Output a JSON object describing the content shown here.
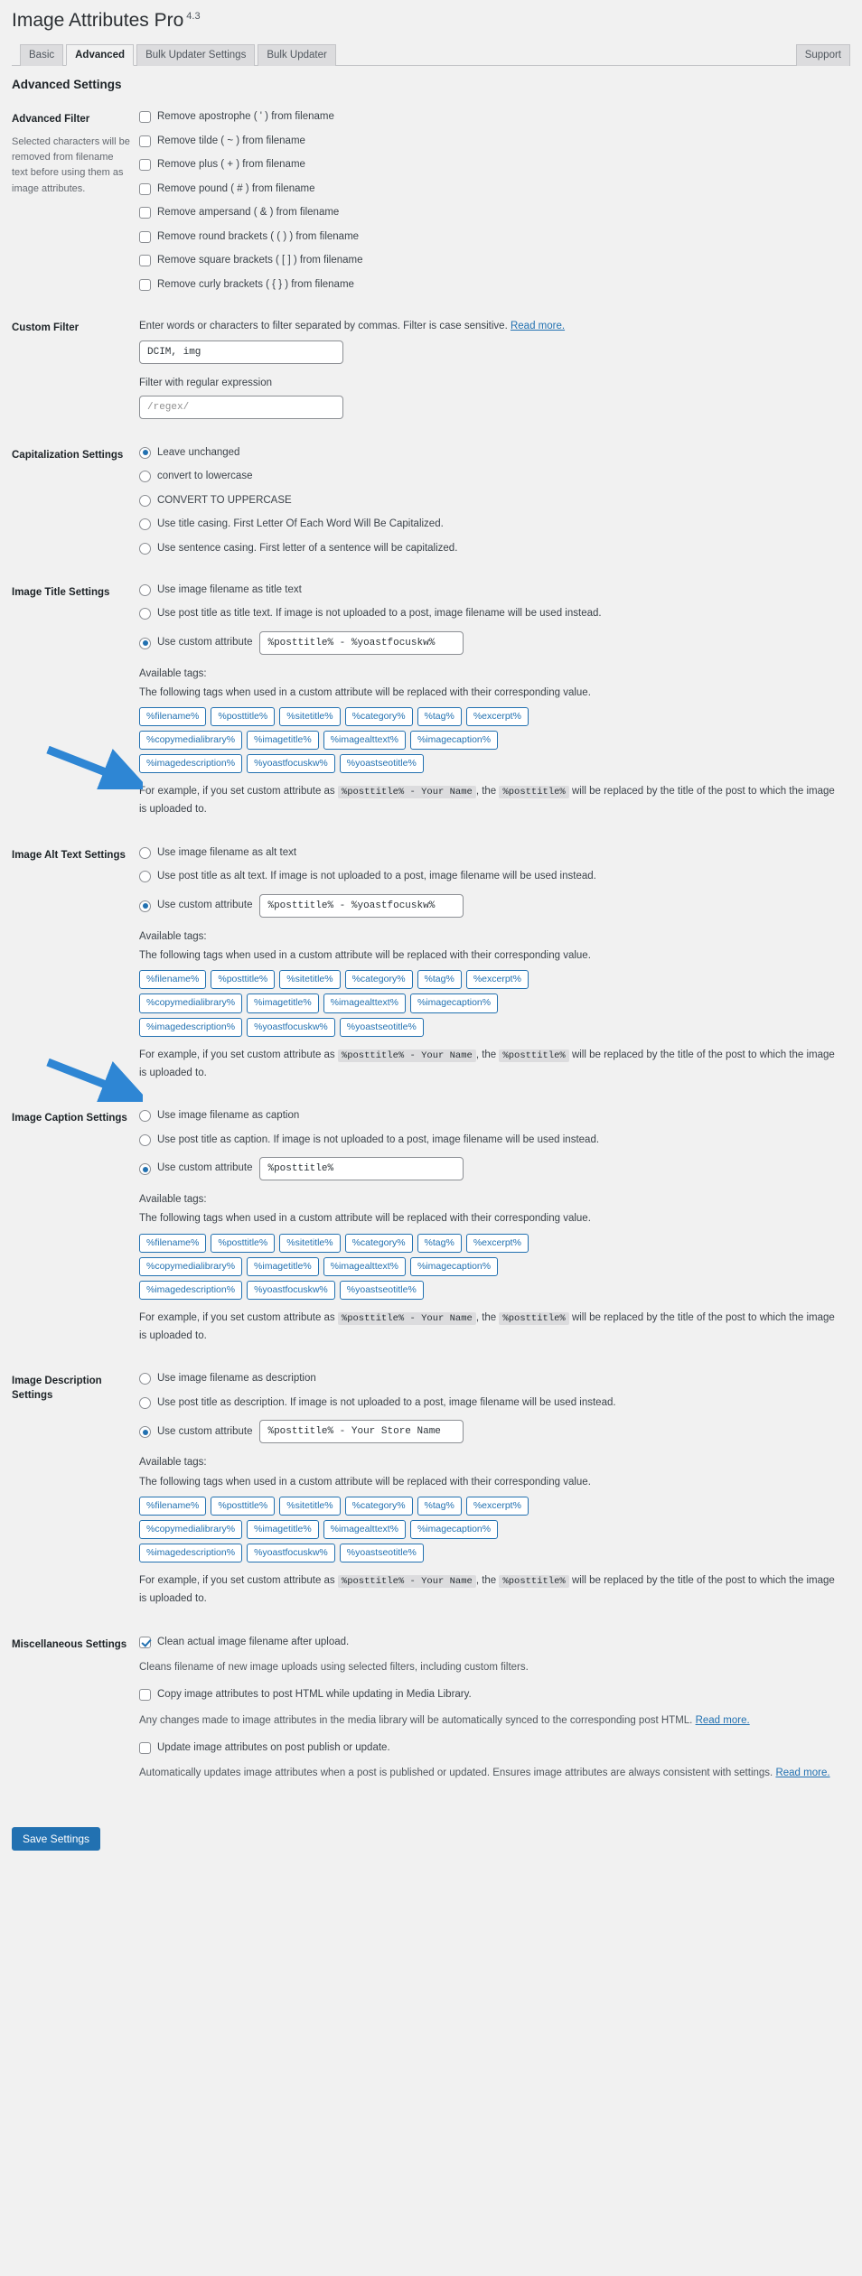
{
  "header": {
    "title": "Image Attributes Pro",
    "version": "4.3"
  },
  "tabs": [
    {
      "label": "Basic",
      "active": false
    },
    {
      "label": "Advanced",
      "active": true
    },
    {
      "label": "Bulk Updater Settings",
      "active": false
    },
    {
      "label": "Bulk Updater",
      "active": false
    }
  ],
  "support_tab": {
    "label": "Support"
  },
  "page_heading": "Advanced Settings",
  "advanced_filter": {
    "label": "Advanced Filter",
    "description": "Selected characters will be removed from filename text before using them as image attributes.",
    "options": [
      {
        "label": "Remove apostrophe ( ' ) from filename",
        "checked": false
      },
      {
        "label": "Remove tilde ( ~ ) from filename",
        "checked": false
      },
      {
        "label": "Remove plus ( + ) from filename",
        "checked": false
      },
      {
        "label": "Remove pound ( # ) from filename",
        "checked": false
      },
      {
        "label": "Remove ampersand ( & ) from filename",
        "checked": false
      },
      {
        "label": "Remove round brackets ( ( ) ) from filename",
        "checked": false
      },
      {
        "label": "Remove square brackets ( [ ] ) from filename",
        "checked": false
      },
      {
        "label": "Remove curly brackets ( { } ) from filename",
        "checked": false
      }
    ]
  },
  "custom_filter": {
    "label": "Custom Filter",
    "note": "Enter words or characters to filter separated by commas. Filter is case sensitive.",
    "read_more": "Read more.",
    "words_value": "DCIM, img",
    "regex_note": "Filter with regular expression",
    "regex_placeholder": "/regex/",
    "regex_value": ""
  },
  "capitalization": {
    "label": "Capitalization Settings",
    "options": [
      {
        "label": "Leave unchanged",
        "selected": true
      },
      {
        "label": "convert to lowercase",
        "selected": false
      },
      {
        "label": "CONVERT TO UPPERCASE",
        "selected": false
      },
      {
        "label": "Use title casing. First Letter Of Each Word Will Be Capitalized.",
        "selected": false
      },
      {
        "label": "Use sentence casing. First letter of a sentence will be capitalized.",
        "selected": false
      }
    ]
  },
  "tags_common": {
    "available_label": "Available tags:",
    "available_sub": "The following tags when used in a custom attribute will be replaced with their corresponding value.",
    "chips": [
      "%filename%",
      "%posttitle%",
      "%sitetitle%",
      "%category%",
      "%tag%",
      "%excerpt%",
      "%copymedialibrary%",
      "%imagetitle%",
      "%imagealttext%",
      "%imagecaption%",
      "%imagedescription%",
      "%yoastfocuskw%",
      "%yoastseotitle%"
    ],
    "example_pre": "For example, if you set custom attribute as",
    "example_code1": "%posttitle% - Your Name",
    "example_mid": ", the",
    "example_code2": "%posttitle%",
    "example_post": "will be replaced by the title of the post to which the image is uploaded to."
  },
  "image_title": {
    "label": "Image Title Settings",
    "options": [
      {
        "label": "Use image filename as title text",
        "selected": false
      },
      {
        "label": "Use post title as title text. If image is not uploaded to a post, image filename will be used instead.",
        "selected": false
      }
    ],
    "custom_label": "Use custom attribute",
    "custom_selected": true,
    "custom_value": "%posttitle% - %yoastfocuskw%"
  },
  "image_alt": {
    "label": "Image Alt Text Settings",
    "options": [
      {
        "label": "Use image filename as alt text",
        "selected": false
      },
      {
        "label": "Use post title as alt text. If image is not uploaded to a post, image filename will be used instead.",
        "selected": false
      }
    ],
    "custom_label": "Use custom attribute",
    "custom_selected": true,
    "custom_value": "%posttitle% - %yoastfocuskw%"
  },
  "image_caption": {
    "label": "Image Caption Settings",
    "options": [
      {
        "label": "Use image filename as caption",
        "selected": false
      },
      {
        "label": "Use post title as caption. If image is not uploaded to a post, image filename will be used instead.",
        "selected": false
      }
    ],
    "custom_label": "Use custom attribute",
    "custom_selected": true,
    "custom_value": "%posttitle%"
  },
  "image_description": {
    "label": "Image Description Settings",
    "options": [
      {
        "label": "Use image filename as description",
        "selected": false
      },
      {
        "label": "Use post title as description. If image is not uploaded to a post, image filename will be used instead.",
        "selected": false
      }
    ],
    "custom_label": "Use custom attribute",
    "custom_selected": true,
    "custom_value": "%posttitle% - Your Store Name"
  },
  "miscellaneous": {
    "label": "Miscellaneous Settings",
    "clean_filename": {
      "label": "Clean actual image filename after upload.",
      "checked": true,
      "note": "Cleans filename of new image uploads using selected filters, including custom filters."
    },
    "copy_attributes": {
      "label": "Copy image attributes to post HTML while updating in Media Library.",
      "checked": false,
      "note": "Any changes made to image attributes in the media library will be automatically synced to the corresponding post HTML.",
      "read_more": "Read more."
    },
    "update_on_publish": {
      "label": "Update image attributes on post publish or update.",
      "checked": false,
      "note": "Automatically updates image attributes when a post is published or updated. Ensures image attributes are always consistent with settings.",
      "read_more": "Read more."
    }
  },
  "save_button": {
    "label": "Save Settings"
  },
  "colors": {
    "accent": "#2271b1",
    "background": "#f1f1f1",
    "arrow": "#2e86d4"
  }
}
